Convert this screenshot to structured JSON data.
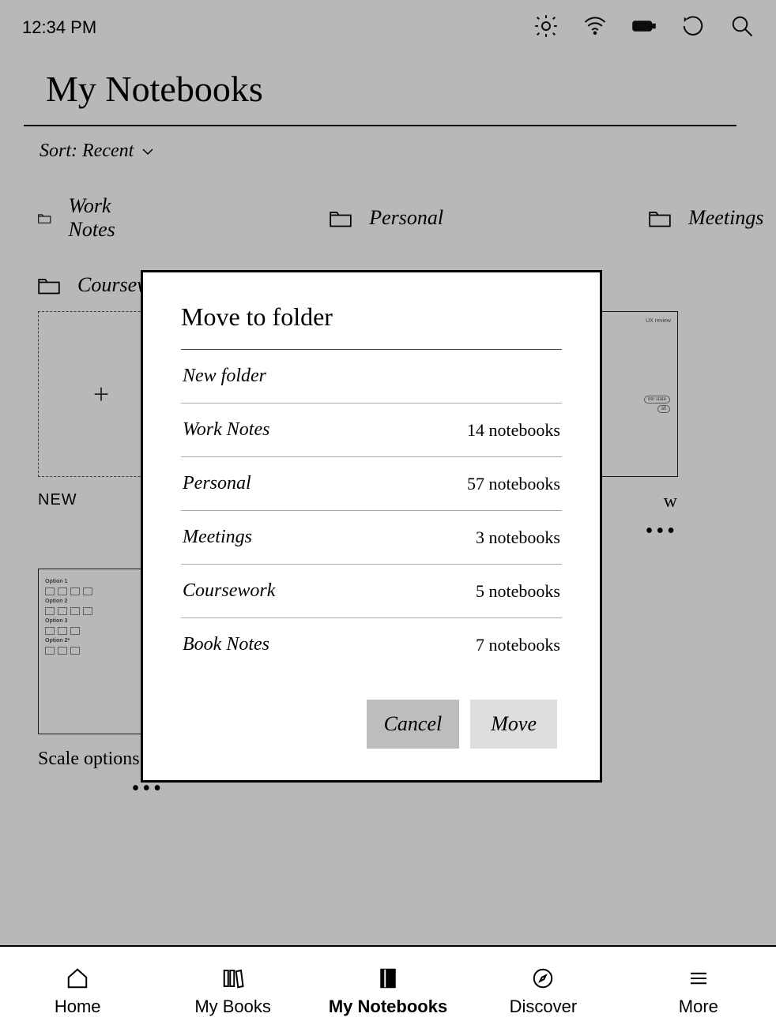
{
  "status": {
    "time": "12:34 PM"
  },
  "page": {
    "title": "My Notebooks"
  },
  "sort": {
    "label": "Sort: Recent"
  },
  "folders": [
    {
      "name": "Work Notes"
    },
    {
      "name": "Personal"
    },
    {
      "name": "Meetings"
    },
    {
      "name": "Coursework"
    },
    {
      "name": "Book Notes"
    }
  ],
  "thumbs": {
    "new_label": "NEW",
    "right_label_partial": "w",
    "right_title_partial": "UX review",
    "scale_label": "Scale options",
    "sketch_opts": [
      "Option 1",
      "Option 2",
      "Option 3",
      "Option 2*"
    ]
  },
  "modal": {
    "title": "Move to folder",
    "new_folder": "New folder",
    "rows": [
      {
        "name": "Work Notes",
        "count": "14 notebooks"
      },
      {
        "name": "Personal",
        "count": "57 notebooks"
      },
      {
        "name": "Meetings",
        "count": "3 notebooks"
      },
      {
        "name": "Coursework",
        "count": "5 notebooks"
      },
      {
        "name": "Book Notes",
        "count": "7 notebooks"
      }
    ],
    "cancel": "Cancel",
    "move": "Move"
  },
  "nav": {
    "home": "Home",
    "my_books": "My Books",
    "my_notebooks": "My Notebooks",
    "discover": "Discover",
    "more": "More"
  }
}
